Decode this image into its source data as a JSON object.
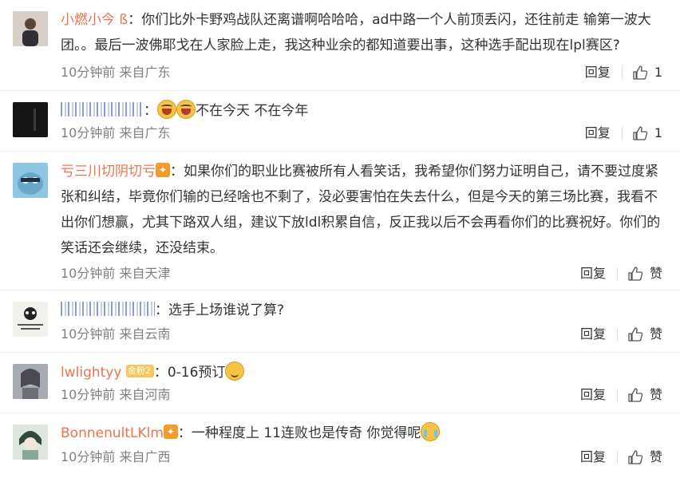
{
  "comments": [
    {
      "id": 1,
      "username": "小燃小今 ß",
      "body": "你们比外卡野鸡战队还离谱啊哈哈哈，ad中路一个人前顶丢闪，还往前走 输第一波大团。。最后一波佛耶戈在人家脸上走，我这种业余的都知道要出事，这种选手配出现在lpl赛区?",
      "time": "10分钟前",
      "location": "来自广东",
      "reply_label": "回复",
      "like_label": "1",
      "avatar_color": "#c7bbb0"
    },
    {
      "id": 2,
      "username": "",
      "body": "不在今天 不在今年",
      "time": "10分钟前",
      "location": "来自广东",
      "reply_label": "回复",
      "like_label": "1",
      "avatar_color": "#1c1c1c"
    },
    {
      "id": 3,
      "username": "亏三川切阴切亏",
      "body": "如果你们的职业比赛被所有人看笑话，我希望你们努力证明自己，请不要过度紧张和纠结，毕竟你们输的已经啥也不剩了，没必要害怕在失去什么，但是今天的第三场比赛，我看不出你们想赢，尤其下路双人组，建议下放ldl积累自信，反正我以后不会再看你们的比赛祝好。你们的笑话还会继续，还没结束。",
      "time": "10分钟前",
      "location": "来自天津",
      "reply_label": "回复",
      "like_label": "赞",
      "avatar_color": "#7fb8d6"
    },
    {
      "id": 4,
      "username": "",
      "body": "选手上场谁说了算?",
      "time": "10分钟前",
      "location": "来自云南",
      "reply_label": "回复",
      "like_label": "赞",
      "avatar_color": "#dfe8df"
    },
    {
      "id": 5,
      "username": "lwlightyy",
      "badge": "金粉2",
      "body": "0-16预订",
      "time": "10分钟前",
      "location": "来自河南",
      "reply_label": "回复",
      "like_label": "赞",
      "avatar_color": "#9aa0a8"
    },
    {
      "id": 6,
      "username": "BonnenultLKlm",
      "body": "一种程度上 11连败也是传奇 你觉得呢",
      "time": "10分钟前",
      "location": "来自广西",
      "reply_label": "回复",
      "like_label": "赞",
      "avatar_color": "#bfd2c6"
    }
  ],
  "colors": {
    "username": "#eb7350",
    "meta": "#808080",
    "text": "#333333"
  },
  "icons": {
    "like": "thumbs-up-icon"
  }
}
